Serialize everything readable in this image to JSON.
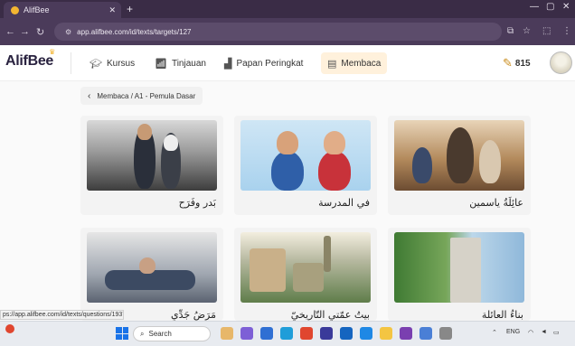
{
  "browser": {
    "tab_title": "AlifBee",
    "url": "app.alifbee.com/id/texts/targets/127",
    "new_tab_symbol": "+",
    "status_url": "ps://app.alifbee.com/id/texts/questions/1937"
  },
  "app": {
    "logo": "AlifBee",
    "nav": [
      {
        "label": "Kursus",
        "icon": "graduation-cap-icon"
      },
      {
        "label": "Tinjauan",
        "icon": "bar-chart-icon"
      },
      {
        "label": "Papan Peringkat",
        "icon": "podium-icon"
      },
      {
        "label": "Membaca",
        "icon": "book-open-icon",
        "active": true
      }
    ],
    "coins": "815",
    "accent": "#fff1dc"
  },
  "breadcrumb": {
    "text": "Membaca / A1 - Pemula Dasar"
  },
  "cards": [
    {
      "title": "بَدر وفَرَح"
    },
    {
      "title": "في المدرسة"
    },
    {
      "title": "عائِلَةُ ياسمين"
    },
    {
      "title": "مَرَضُ جَدِّي"
    },
    {
      "title": "بيتُ عمّتي التّاريخيّ"
    },
    {
      "title": "بناءُ العائلة"
    }
  ],
  "taskbar": {
    "search_placeholder": "Search",
    "lang": "ENG"
  }
}
